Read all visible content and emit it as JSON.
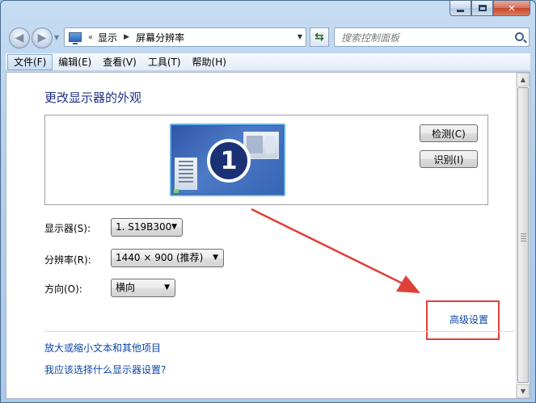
{
  "window": {
    "caption_buttons": [
      "minimize-icon",
      "maximize-icon",
      "close-icon"
    ]
  },
  "nav": {
    "back_icon": "back-arrow-icon",
    "forward_icon": "forward-arrow-icon",
    "breadcrumb": {
      "overflow": "«",
      "items": [
        "显示",
        "屏幕分辨率"
      ]
    },
    "refresh_icon": "refresh-icon"
  },
  "search": {
    "placeholder": "搜索控制面板"
  },
  "menu": {
    "items": [
      {
        "label": "文件(F)"
      },
      {
        "label": "编辑(E)"
      },
      {
        "label": "查看(V)"
      },
      {
        "label": "工具(T)"
      },
      {
        "label": "帮助(H)"
      }
    ]
  },
  "main": {
    "title": "更改显示器的外观",
    "monitor_number": "1",
    "detect_label": "检测(C)",
    "identify_label": "识别(I)",
    "display_label": "显示器(S):",
    "display_value": "1. S19B300",
    "resolution_label": "分辨率(R):",
    "resolution_value": "1440 × 900 (推荐)",
    "orientation_label": "方向(O):",
    "orientation_value": "横向",
    "advanced_link": "高级设置",
    "text_size_link": "放大或缩小文本和其他项目",
    "which_settings_link": "我应该选择什么显示器设置?"
  },
  "annotation": {
    "color": "#e0403a"
  }
}
